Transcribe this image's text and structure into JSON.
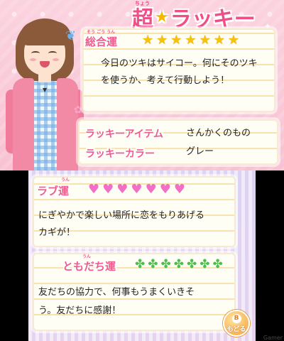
{
  "top": {
    "title_main": "超",
    "title_sub": "ラッキー",
    "title_ruby": "ちょう",
    "overall": {
      "label": "総合運",
      "ruby": "そう ごう うん",
      "stars_filled": 7,
      "stars_total": 7,
      "message_line1": "今日のツキはサイコー。何にそのツキ",
      "message_line2": "を使うか、考えて行動しよう！"
    },
    "lucky_item": {
      "label": "ラッキーアイテム",
      "value": "さんかくのもの"
    },
    "lucky_color": {
      "label": "ラッキーカラー",
      "value": "グレー"
    }
  },
  "bottom": {
    "love": {
      "label": "ラブ運",
      "ruby": "うん",
      "hearts": 7,
      "message_line1": "にぎやかで楽しい場所に恋をもりあげる",
      "message_line2": "カギが！"
    },
    "friend": {
      "label": "ともだち運",
      "ruby": "うん",
      "clovers": 7,
      "message_line1": "友だちの協力で、何事もうまくいきそ",
      "message_line2": "う。友だちに感謝！"
    },
    "back_button": {
      "key": "B",
      "label": "もどる"
    }
  },
  "watermark": "Gamer",
  "colors": {
    "accent_pink": "#ef5c8e",
    "star": "#f6c20a",
    "heart": "#f36fc5",
    "clover": "#4bbf4b"
  },
  "icons": {
    "star": "star-icon",
    "heart": "heart-icon",
    "clover": "clover-icon"
  }
}
